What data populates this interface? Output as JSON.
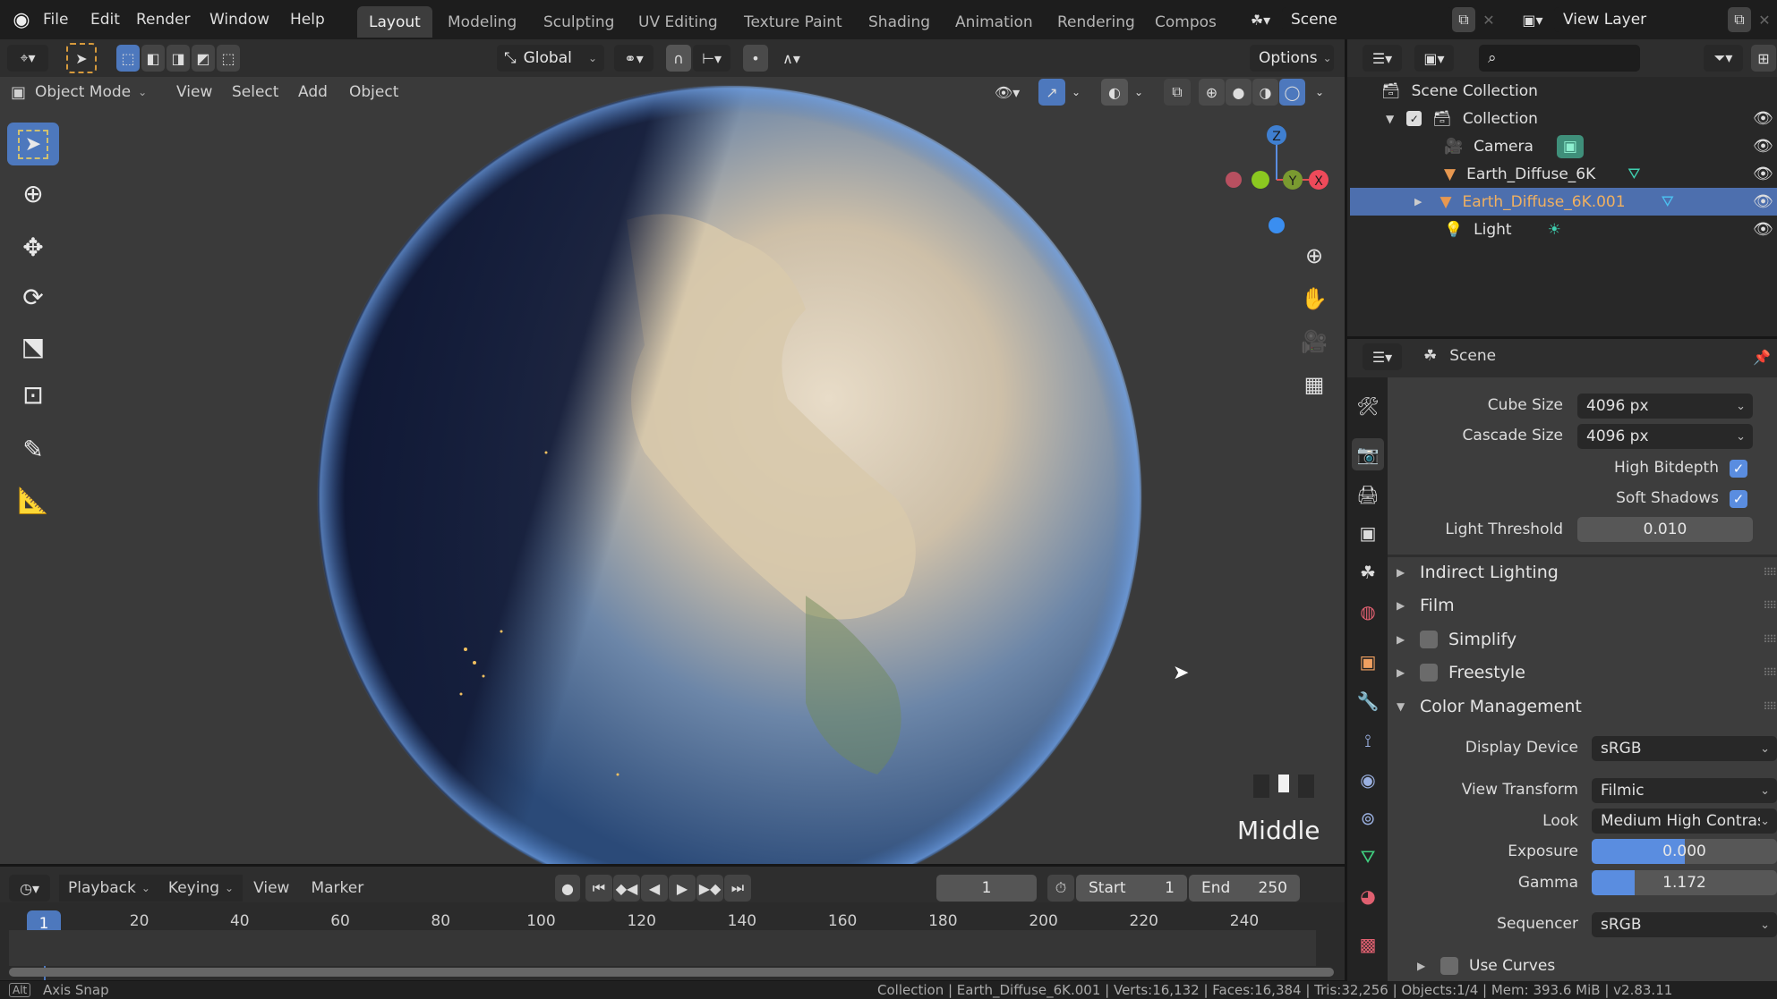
{
  "app": {
    "name": "Blender",
    "logo_icon": "blender-logo-icon"
  },
  "topbar": {
    "menus": [
      "File",
      "Edit",
      "Render",
      "Window",
      "Help"
    ],
    "workspace_tabs": [
      "Layout",
      "Modeling",
      "Sculpting",
      "UV Editing",
      "Texture Paint",
      "Shading",
      "Animation",
      "Rendering",
      "Compos"
    ],
    "active_tab": "Layout",
    "scene_name": "Scene",
    "view_layer_name": "View Layer"
  },
  "tool_header": {
    "transform_orientation": "Global",
    "options_label": "Options"
  },
  "viewport": {
    "mode": "Object Mode",
    "menus": [
      "View",
      "Select",
      "Add",
      "Object"
    ],
    "gizmo_axes": {
      "z": "Z",
      "y": "Y",
      "x": "X"
    },
    "pivot_label": "Middle",
    "tools": [
      "select-box",
      "cursor",
      "move",
      "rotate",
      "scale",
      "transform",
      "annotate",
      "measure"
    ],
    "nav_icons": [
      "zoom-icon",
      "pan-hand-icon",
      "camera-view-icon",
      "ortho-grid-icon"
    ]
  },
  "outliner": {
    "search_placeholder": "",
    "root": "Scene Collection",
    "collection": "Collection",
    "items": [
      {
        "name": "Camera",
        "type": "camera",
        "selected": false
      },
      {
        "name": "Earth_Diffuse_6K",
        "type": "mesh",
        "selected": false
      },
      {
        "name": "Earth_Diffuse_6K.001",
        "type": "mesh",
        "selected": true
      },
      {
        "name": "Light",
        "type": "light",
        "selected": false
      }
    ]
  },
  "properties": {
    "context": "Scene",
    "fields": {
      "cube_size": {
        "label": "Cube Size",
        "value": "4096 px"
      },
      "cascade_size": {
        "label": "Cascade Size",
        "value": "4096 px"
      },
      "high_bitdepth": {
        "label": "High Bitdepth",
        "checked": true
      },
      "soft_shadows": {
        "label": "Soft Shadows",
        "checked": true
      },
      "light_threshold": {
        "label": "Light Threshold",
        "value": "0.010"
      }
    },
    "sections": [
      {
        "label": "Indirect Lighting",
        "expanded": false,
        "has_checkbox": false
      },
      {
        "label": "Film",
        "expanded": false,
        "has_checkbox": false
      },
      {
        "label": "Simplify",
        "expanded": false,
        "has_checkbox": true,
        "checked": false
      },
      {
        "label": "Freestyle",
        "expanded": false,
        "has_checkbox": true,
        "checked": false
      },
      {
        "label": "Color Management",
        "expanded": true,
        "has_checkbox": false
      }
    ],
    "color_management": {
      "display_device": {
        "label": "Display Device",
        "value": "sRGB"
      },
      "view_transform": {
        "label": "View Transform",
        "value": "Filmic"
      },
      "look": {
        "label": "Look",
        "value": "Medium High Contras"
      },
      "exposure": {
        "label": "Exposure",
        "value": "0.000",
        "fill_fraction": 0.5
      },
      "gamma": {
        "label": "Gamma",
        "value": "1.172",
        "fill_fraction": 0.23
      },
      "sequencer": {
        "label": "Sequencer",
        "value": "sRGB"
      },
      "use_curves": {
        "label": "Use Curves",
        "checked": false
      }
    }
  },
  "timeline": {
    "menus": [
      "Playback",
      "Keying",
      "View",
      "Marker"
    ],
    "current_frame": "1",
    "start_label": "Start",
    "start": "1",
    "end_label": "End",
    "end": "250",
    "ticks": [
      "20",
      "40",
      "60",
      "80",
      "100",
      "120",
      "140",
      "160",
      "180",
      "200",
      "220",
      "240"
    ],
    "playhead": "1"
  },
  "statusbar": {
    "left": "Axis Snap",
    "left_key": "Alt",
    "right": "Collection | Earth_Diffuse_6K.001 | Verts:16,132 | Faces:16,384 | Tris:32,256 | Objects:1/4 | Mem: 393.6 MiB | v2.83.11"
  }
}
